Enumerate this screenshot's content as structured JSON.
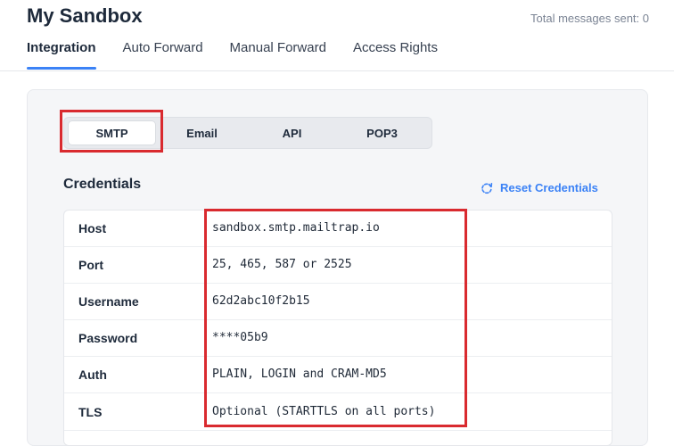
{
  "header": {
    "title": "My Sandbox",
    "total_messages": "Total messages sent: 0"
  },
  "tabs": [
    {
      "label": "Integration",
      "active": true
    },
    {
      "label": "Auto Forward",
      "active": false
    },
    {
      "label": "Manual Forward",
      "active": false
    },
    {
      "label": "Access Rights",
      "active": false
    }
  ],
  "protocol_switch": {
    "options": [
      "SMTP",
      "Email",
      "API",
      "POP3"
    ],
    "selected": "SMTP"
  },
  "credentials": {
    "title": "Credentials",
    "reset_label": "Reset Credentials",
    "reset_icon": "refresh-icon",
    "rows": [
      {
        "label": "Host",
        "value": "sandbox.smtp.mailtrap.io"
      },
      {
        "label": "Port",
        "value": "25, 465, 587 or 2525"
      },
      {
        "label": "Username",
        "value": "62d2abc10f2b15"
      },
      {
        "label": "Password",
        "value": "****05b9"
      },
      {
        "label": "Auth",
        "value": "PLAIN, LOGIN and CRAM-MD5"
      },
      {
        "label": "TLS",
        "value": "Optional (STARTTLS on all ports)"
      }
    ]
  },
  "colors": {
    "accent": "#3b82f6",
    "highlight": "#d92a2f",
    "text": "#1e2a3b"
  }
}
